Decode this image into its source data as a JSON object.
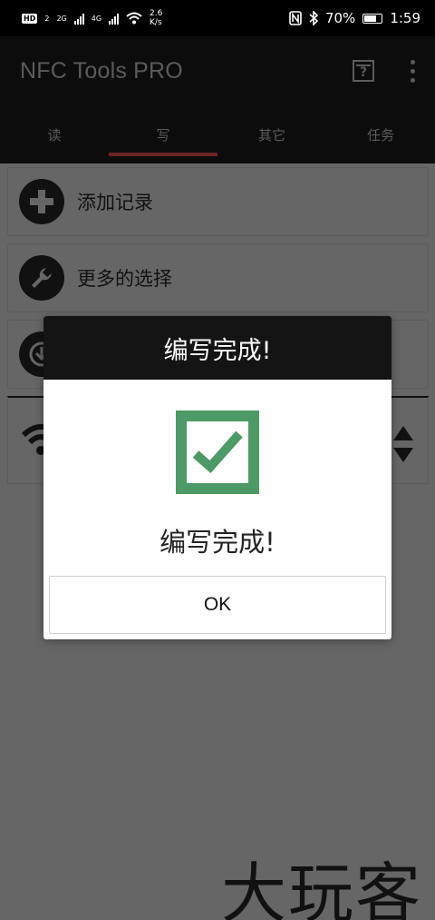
{
  "status_bar": {
    "hd": "HD",
    "hd_num": "2",
    "net1": "2G",
    "net2": "4G",
    "speed_value": "2.6",
    "speed_unit": "K/s",
    "battery": "70%",
    "time": "1:59"
  },
  "app": {
    "title": "NFC Tools PRO",
    "help_glyph": "?",
    "tabs": [
      {
        "label": "读"
      },
      {
        "label": "写"
      },
      {
        "label": "其它"
      },
      {
        "label": "任务"
      }
    ],
    "active_tab": "写"
  },
  "list": {
    "items": [
      {
        "label": "添加记录",
        "icon": "plus-icon"
      },
      {
        "label": "更多的选择",
        "icon": "wrench-icon"
      },
      {
        "label": "",
        "icon": "download-icon"
      }
    ],
    "record_icons": [
      "wifi-icon",
      "sort-icon"
    ]
  },
  "dialog": {
    "title": "编写完成!",
    "message": "编写完成!",
    "ok_label": "OK",
    "check_color": "#4c9a65"
  },
  "watermark": "大玩客",
  "colors": {
    "accent": "#6b2323",
    "dim_background": "#666666"
  }
}
